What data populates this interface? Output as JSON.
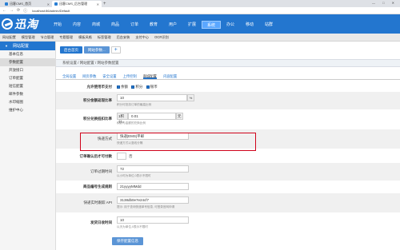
{
  "browser": {
    "tabs": [
      {
        "label": "迅客CMS_首页",
        "active": false
      },
      {
        "label": "迅客CMS_后台管理",
        "active": true
      }
    ],
    "new_tab": "+",
    "window_controls": "— □ ✕",
    "url": "localhost:86/admin/Default"
  },
  "brand": {
    "logo_text": "迅淘",
    "accent": "#2376cf"
  },
  "top_menu": [
    "开始",
    "内容",
    "商城",
    "商品",
    "订单",
    "教育",
    "用户",
    "扩展",
    "系统",
    "办公",
    "移动",
    "站群"
  ],
  "top_menu_active": 8,
  "sub_menu": [
    "网站配置",
    "模型管理",
    "节点管理",
    "专题管理",
    "模板风格",
    "标签管理",
    "后台安装",
    "支付中心",
    "OCR识别"
  ],
  "sidebar": {
    "header": "网站配置",
    "items": [
      "基本信息",
      "参数配置",
      "开放接口",
      "订单配置",
      "短信配置",
      "邮件参数",
      "水印缩图",
      "维护中心"
    ],
    "active": 1
  },
  "page_tabs": [
    {
      "label": "后台首页",
      "style": "dark"
    },
    {
      "label": "网站参数...",
      "style": "light"
    }
  ],
  "add_tab": "+",
  "breadcrumb": "系统设置 / 网站配置 / 网站参数配置",
  "settings_tabs": [
    "全局设置",
    "网页参数",
    "安全设置",
    "上传控制",
    "商城配置",
    "内容配置"
  ],
  "settings_tab_active": 4,
  "form": {
    "pay_allowed": {
      "label": "允许使用币支付",
      "options": [
        "余额",
        "积分",
        "银币"
      ]
    },
    "points_ratio": {
      "label": "积分金额返现比率",
      "value": "10",
      "unit": "%",
      "hint": "积分可抵扣订单的最高比例"
    },
    "points_exchange": {
      "label": "积分兑换抵扣比率",
      "left": "1积分=",
      "value": "0.01",
      "unit": "元",
      "hint": "积分与金额的兑换比例"
    },
    "express": {
      "label": "快递方式",
      "value": "快递|EMS|平邮",
      "hint": "快递方式以竖线分隔"
    },
    "order_confirm": {
      "label": "订单确认后才可付款",
      "value": "否"
    },
    "order_expire": {
      "label": "订单过期时间",
      "value": "72",
      "hint": "以小时为单位,0表示不限时"
    },
    "product_code": {
      "label": "商品编号生成规则",
      "value": "21yyyyMMdd"
    },
    "express_api": {
      "label": "快递实时跟踪 API",
      "value": "3138db0e7e24cf7",
      "hint": "提示: 用于查询快递单号信息, 可登录官网申请"
    },
    "receive_days": {
      "label": "发货日收时间",
      "value": "10",
      "hint": "以天为单位,0表示不限时"
    }
  },
  "save_button": "保存配置信息"
}
